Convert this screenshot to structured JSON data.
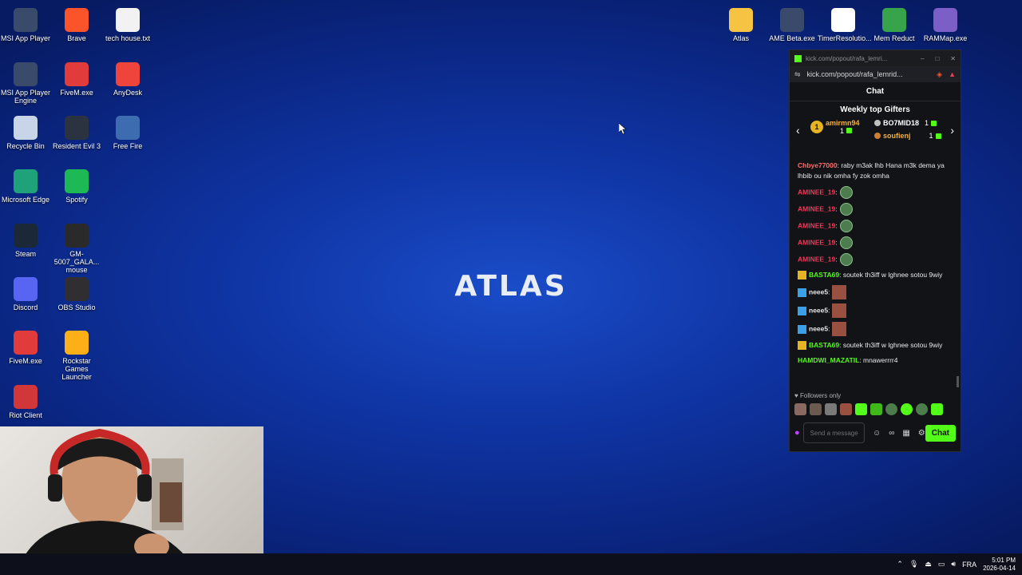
{
  "desktop": {
    "left_icons": [
      {
        "label": "MSI App Player",
        "icon": "msi-app-player-icon"
      },
      {
        "label": "Brave",
        "icon": "brave-icon"
      },
      {
        "label": "tech house.txt",
        "icon": "text-file-icon"
      },
      {
        "label": "MSI App Player Engine",
        "icon": "msi-engine-icon"
      },
      {
        "label": "FiveM.exe",
        "icon": "fivem-icon"
      },
      {
        "label": "AnyDesk",
        "icon": "anydesk-icon"
      },
      {
        "label": "Recycle Bin",
        "icon": "recycle-bin-icon"
      },
      {
        "label": "Resident Evil 3",
        "icon": "resident-evil-icon"
      },
      {
        "label": "Free Fire",
        "icon": "free-fire-icon"
      },
      {
        "label": "Microsoft Edge",
        "icon": "edge-icon"
      },
      {
        "label": "Spotify",
        "icon": "spotify-icon"
      },
      {
        "label": "Steam",
        "icon": "steam-icon"
      },
      {
        "label": "GM-5007_GALA... mouse",
        "icon": "mouse-icon"
      },
      {
        "label": "Discord",
        "icon": "discord-icon"
      },
      {
        "label": "OBS Studio",
        "icon": "obs-icon"
      },
      {
        "label": "FiveM.exe",
        "icon": "fivem-icon"
      },
      {
        "label": "Rockstar Games Launcher",
        "icon": "rockstar-icon"
      },
      {
        "label": "Riot Client",
        "icon": "riot-icon"
      }
    ],
    "right_icons": [
      {
        "label": "Atlas",
        "icon": "folder-icon"
      },
      {
        "label": "AME Beta.exe",
        "icon": "ame-icon"
      },
      {
        "label": "TimerResolutio...",
        "icon": "timer-icon"
      },
      {
        "label": "Mem Reduct",
        "icon": "mem-reduct-icon"
      },
      {
        "label": "RAMMap.exe",
        "icon": "rammap-icon"
      }
    ],
    "wallpaper_logo": "ATLAS"
  },
  "chat_window": {
    "title": "kick.com/popout/rafa_lemri...",
    "url": "kick.com/popout/rafa_lemrid...",
    "header": "Chat",
    "gifters_title": "Weekly top Gifters",
    "gifters": [
      {
        "name": "amirmn94",
        "count": "1",
        "rank": "1"
      },
      {
        "name": "BO7MID18",
        "count": "1"
      },
      {
        "name": "soufienj",
        "count": "1"
      }
    ],
    "messages": [
      {
        "user": "Chbye77000",
        "text": ": raby m3ak lhb Hana m3k dema ya lhbib ou nik omha fy zok omha",
        "color": "#ff6b6b",
        "emotes": 0
      },
      {
        "user": "AMINEE_19",
        "text": ":",
        "color": "#ff3355",
        "emotes": 1
      },
      {
        "user": "AMINEE_19",
        "text": ":",
        "color": "#ff3355",
        "emotes": 1
      },
      {
        "user": "AMINEE_19",
        "text": ":",
        "color": "#ff3355",
        "emotes": 1
      },
      {
        "user": "AMINEE_19",
        "text": ":",
        "color": "#ff3355",
        "emotes": 1
      },
      {
        "user": "AMINEE_19",
        "text": ":",
        "color": "#ff3355",
        "emotes": 1
      },
      {
        "user": "BASTA69",
        "text": ": soutek th3iff w lghnee sotou 9wiy",
        "color": "#53fc18",
        "emotes": 0
      },
      {
        "user": "neee5",
        "text": ":",
        "color": "#e8e8ea",
        "emotes": 1
      },
      {
        "user": "neee5",
        "text": ":",
        "color": "#e8e8ea",
        "emotes": 1
      },
      {
        "user": "neee5",
        "text": ":",
        "color": "#e8e8ea",
        "emotes": 1
      },
      {
        "user": "BASTA69",
        "text": ": soutek th3iff w lghnee sotou 9wiy",
        "color": "#53fc18",
        "emotes": 0
      },
      {
        "user": "HAMDWI_MAZATIL",
        "text": ": mnawerrrr4",
        "color": "#53fc18",
        "emotes": 0
      }
    ],
    "followers_only": "Followers only",
    "input_placeholder": "Send a message",
    "send_button": "Chat",
    "accent": "#53fc18"
  },
  "taskbar": {
    "language": "FRA",
    "time": "5:01 PM",
    "date": "2026-04-14"
  }
}
